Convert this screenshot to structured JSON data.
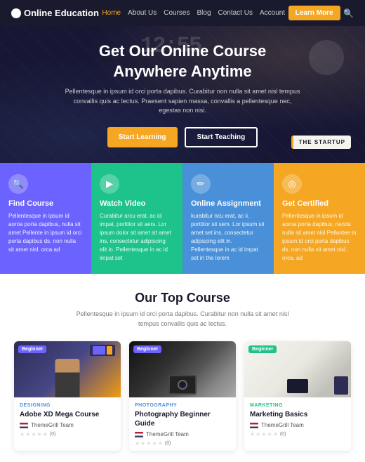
{
  "brand": {
    "name": "Online Education"
  },
  "nav": {
    "links": [
      "Home",
      "About Us",
      "Courses",
      "Blog",
      "Contact Us",
      "Account"
    ],
    "active": "Home",
    "cta": "Learn More"
  },
  "hero": {
    "title": "Get Our Online Course\nAnywhere Anytime",
    "subtitle": "Pellentesque in ipsum id orci porta dapibus. Curabitur non nulla sit amet nisl tempus convallis quis ac lectus. Praesent sapien massa, convallis a pellentesque nec, egestas non nisi.",
    "btn_primary": "Start Learning",
    "btn_outline": "Start Teaching",
    "deco_time": "12:55",
    "deco_startup": "THE STARTUP"
  },
  "features": [
    {
      "icon": "🔍",
      "title": "Find Course",
      "desc": "Pellentesque in ipsum id aoroa porta dapibus, nulla sit amet Pellente in ipsum id orci porta dapibus ds. non nulla sit amet nisl. orca ad"
    },
    {
      "icon": "▶",
      "title": "Watch Video",
      "desc": "Curabitur arcu erat, ac id impat, porttitor sit aers. Lor ipsum dolor sit amet sit amet ins, consectetur adipiscing elit in. Pellentesque in ac id impat set"
    },
    {
      "icon": "✏",
      "title": "Online Assignment",
      "desc": "kurabitur ncu erat, ac ii. porttitor sit sem. Lor ipsum sit amet set ins, consectetur adipiscing elit in. Pellentesque in ac id impat set in the lorem"
    },
    {
      "icon": "◯",
      "title": "Get Certified",
      "desc": "Pellentesque in ipsum id aoroa porta dapibus, nandu nulla sit amet nisl Pellantee in ipsum id orci porta dapibus ds. non nulla sit amet nisl. orca. ad"
    }
  ],
  "courses_section": {
    "title": "Our Top Course",
    "subtitle": "Pellentesque in ipsum id orci porta dapibus. Curabitur non nulla sit amet nisl tempus convallis quis ac lectus."
  },
  "courses": [
    {
      "badge": "Beginner",
      "category": "DESIGNING",
      "category_color": "design",
      "name": "Adobe XD Mega Course",
      "team": "ThemeGrill Team",
      "rating": 0,
      "img_type": "1"
    },
    {
      "badge": "Beginner",
      "category": "PHOTOGRAPHY",
      "category_color": "photo",
      "name": "Photography Beginner Guide",
      "team": "ThemeGrill Team",
      "rating": 0,
      "img_type": "2"
    },
    {
      "badge": "Beginner",
      "category": "MARKETING",
      "category_color": "marketing",
      "name": "Marketing Basics",
      "team": "ThemeGrill Team",
      "rating": 0,
      "img_type": "3"
    }
  ]
}
